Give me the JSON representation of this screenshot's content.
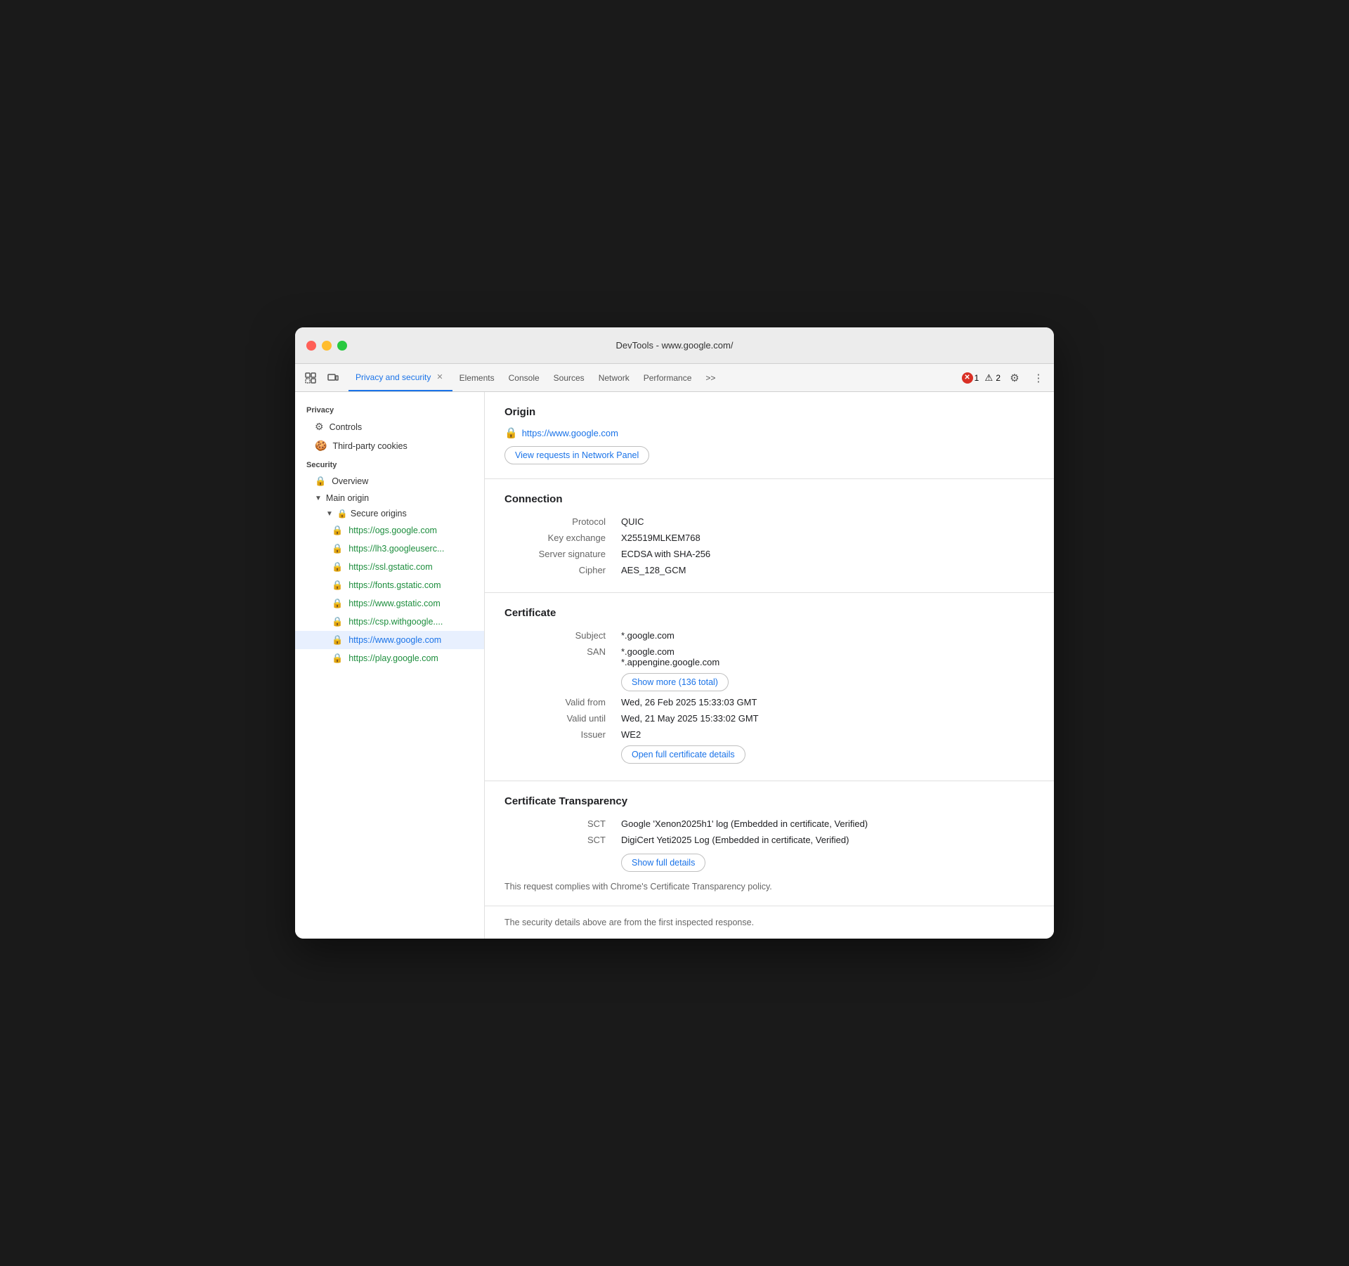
{
  "window": {
    "title": "DevTools - www.google.com/"
  },
  "tabs": [
    {
      "label": "Privacy and security",
      "active": true,
      "closeable": true
    },
    {
      "label": "Elements",
      "active": false
    },
    {
      "label": "Console",
      "active": false
    },
    {
      "label": "Sources",
      "active": false
    },
    {
      "label": "Network",
      "active": false
    },
    {
      "label": "Performance",
      "active": false
    },
    {
      "label": ">>",
      "active": false
    }
  ],
  "errors": {
    "error_count": "1",
    "warning_count": "2"
  },
  "sidebar": {
    "privacy_label": "Privacy",
    "controls_label": "Controls",
    "third_party_cookies_label": "Third-party cookies",
    "security_label": "Security",
    "overview_label": "Overview",
    "main_origin_label": "Main origin",
    "secure_origins_label": "Secure origins",
    "origins": [
      {
        "url": "https://ogs.google.com",
        "active": false
      },
      {
        "url": "https://lh3.googleuserc...",
        "active": false
      },
      {
        "url": "https://ssl.gstatic.com",
        "active": false
      },
      {
        "url": "https://fonts.gstatic.com",
        "active": false
      },
      {
        "url": "https://www.gstatic.com",
        "active": false
      },
      {
        "url": "https://csp.withgoogle....",
        "active": false
      },
      {
        "url": "https://www.google.com",
        "active": true
      },
      {
        "url": "https://play.google.com",
        "active": false
      }
    ]
  },
  "content": {
    "origin_title": "Origin",
    "origin_url": "https://www.google.com",
    "view_requests_btn": "View requests in Network Panel",
    "connection_title": "Connection",
    "connection": {
      "protocol_label": "Protocol",
      "protocol_value": "QUIC",
      "key_exchange_label": "Key exchange",
      "key_exchange_value": "X25519MLKEM768",
      "server_signature_label": "Server signature",
      "server_signature_value": "ECDSA with SHA-256",
      "cipher_label": "Cipher",
      "cipher_value": "AES_128_GCM"
    },
    "certificate_title": "Certificate",
    "certificate": {
      "subject_label": "Subject",
      "subject_value": "*.google.com",
      "san_label": "SAN",
      "san_value1": "*.google.com",
      "san_value2": "*.appengine.google.com",
      "show_more_btn": "Show more (136 total)",
      "valid_from_label": "Valid from",
      "valid_from_value": "Wed, 26 Feb 2025 15:33:03 GMT",
      "valid_until_label": "Valid until",
      "valid_until_value": "Wed, 21 May 2025 15:33:02 GMT",
      "issuer_label": "Issuer",
      "issuer_value": "WE2",
      "open_cert_btn": "Open full certificate details"
    },
    "transparency_title": "Certificate Transparency",
    "transparency": {
      "sct1_label": "SCT",
      "sct1_value": "Google 'Xenon2025h1' log (Embedded in certificate, Verified)",
      "sct2_label": "SCT",
      "sct2_value": "DigiCert Yeti2025 Log (Embedded in certificate, Verified)",
      "show_full_details_btn": "Show full details",
      "compliance_text": "This request complies with Chrome's Certificate Transparency policy."
    },
    "footer_note": "The security details above are from the first inspected response."
  }
}
